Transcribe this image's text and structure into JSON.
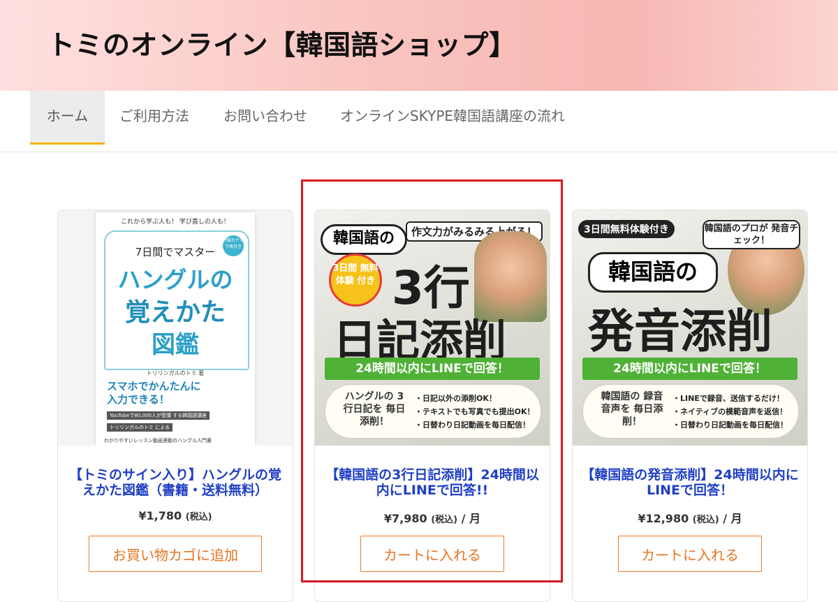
{
  "header": {
    "site_title": "トミのオンライン【韓国語ショップ】"
  },
  "nav": {
    "items": [
      {
        "label": "ホーム",
        "active": true
      },
      {
        "label": "ご利用方法"
      },
      {
        "label": "お問い合わせ"
      },
      {
        "label": "オンラインSKYPE韓国語講座の流れ"
      }
    ]
  },
  "products": [
    {
      "title": "【トミのサイン入り】ハングルの覚えかた図鑑（書籍・送料無料）",
      "price": "¥1,780",
      "tax_label": "(税込)",
      "period": "",
      "button": "お買い物カゴに追加",
      "image": {
        "tagline": "これから学ぶ人も！ 学び直しの人も！",
        "subtitle": "7日間でマスター",
        "title_line1": "ハングルの",
        "title_line2": "覚えかた",
        "title_line3": "図鑑",
        "badge": "特製カナダラ表付き",
        "author": "トリリンガルのトミ 著",
        "lower_heading_1": "スマホでかんたんに",
        "lower_heading_2": "入力できる！",
        "lower_row_1": "YouTubeで80,000人が受講 する韓国語講座",
        "lower_row_2": "トリリンガルのトミ による",
        "lower_foot": "わかりやすいレッスン動画連動のハングル入門書"
      }
    },
    {
      "title": "【韓国語の3行日記添削】24時間以内にLINEで回答!!",
      "price": "¥7,980",
      "tax_label": "(税込)",
      "period": " / 月",
      "button": "カートに入れる",
      "image": {
        "pill": "韓国語の",
        "catch": "作文力がみるみる上がる！",
        "trial": "3日間 無料体験 付き",
        "big1": "3行",
        "big2": "日記添削",
        "green_bar": "24時間以内にLINEで回答！",
        "laurel": "ハングルの 3行日記を 毎日添削！",
        "bullets": [
          "・日記以外の添削OK！",
          "・テキストでも写真でも提出OK！",
          "・日替わり日記動画を毎日配信！"
        ]
      }
    },
    {
      "title": "【韓国語の発音添削】24時間以内にLINEで回答！",
      "price": "¥12,980",
      "tax_label": "(税込)",
      "period": " / 月",
      "button": "カートに入れる",
      "image": {
        "trial": "3日間無料体験付き",
        "catch": "韓国語のプロが 発音チェック！",
        "pill": "韓国語の",
        "big": "発音添削",
        "green_bar": "24時間以内にLINEで回答！",
        "laurel": "韓国語の 録音音声を 毎日添削！",
        "bullets": [
          "・LINEで録音、送信するだけ！",
          "・ネイティブの模範音声を返信！",
          "・日替わり日記動画を毎日配信！"
        ]
      }
    }
  ],
  "colors": {
    "accent_orange": "#e6731f",
    "link_blue": "#1f3fc4",
    "highlight_red": "#d7181f",
    "nav_indicator": "#f2b400"
  }
}
